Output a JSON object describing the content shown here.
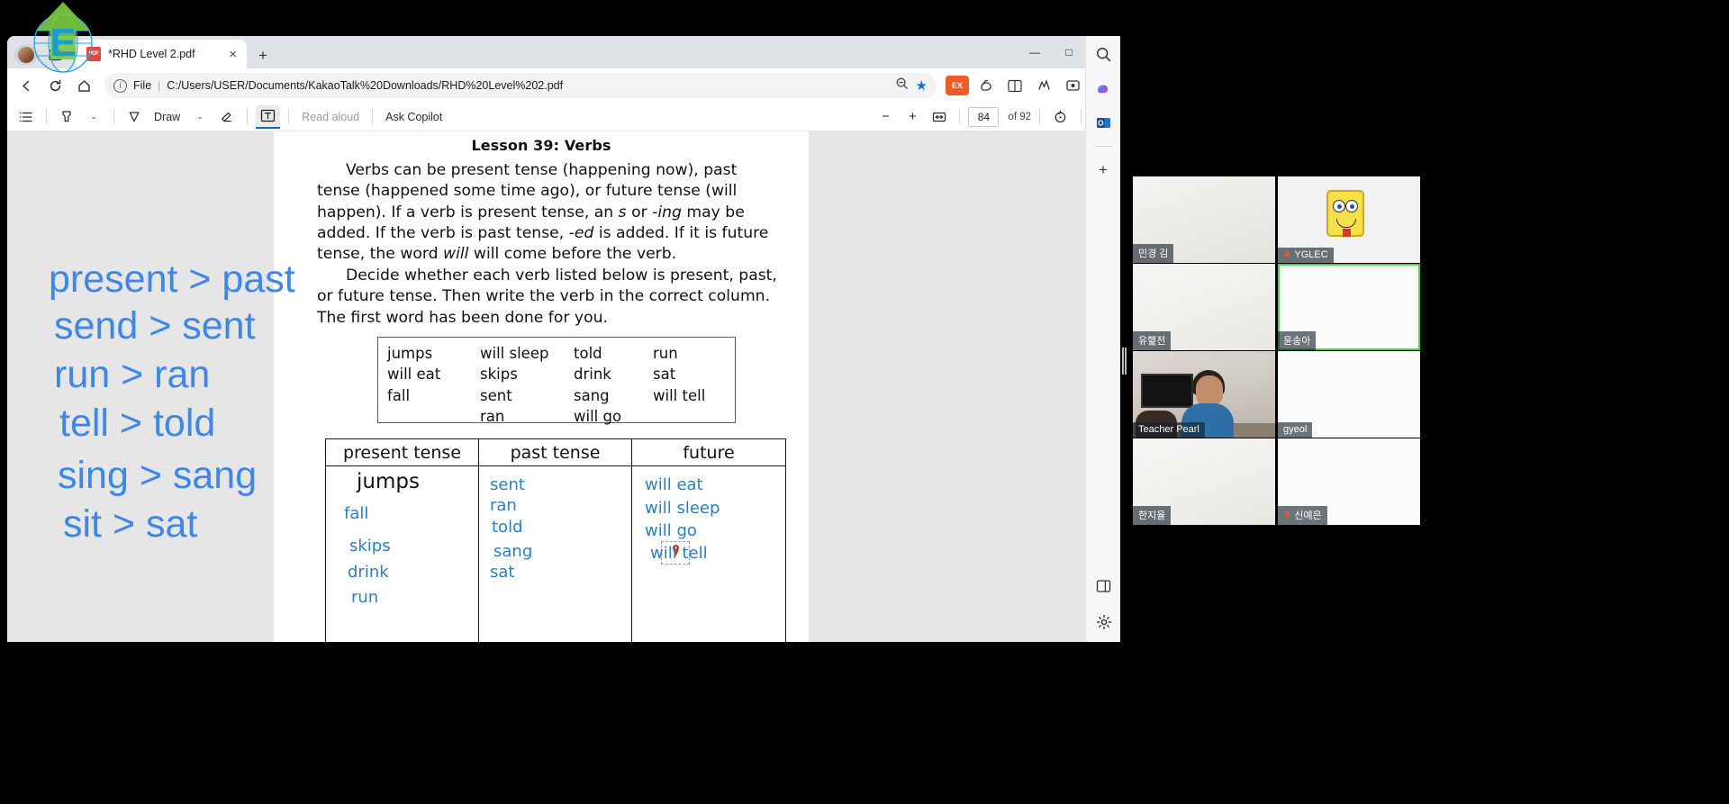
{
  "window": {
    "tab_title": "*RHD Level 2.pdf",
    "tab_close_label": "×",
    "new_tab_label": "+",
    "minimize_label": "—",
    "maximize_label": "□",
    "close_label": "✕",
    "profile_icon": "profile-avatar-icon",
    "split_screen_icon": "split-screen-icon"
  },
  "navbar": {
    "back_icon": "back-arrow-icon",
    "refresh_icon": "refresh-icon",
    "home_icon": "home-icon",
    "info_icon": "info-icon",
    "scheme_label": "File",
    "separator": "|",
    "url": "C:/Users/USER/Documents/KakaoTalk%20Downloads/RHD%20Level%202.pdf",
    "zoom_icon": "zoom-out-page-icon",
    "favorite_icon": "star-filled-icon",
    "extension_label": "EX",
    "copilot_icon": "copilot-icon",
    "split_icon": "split-screen-icon",
    "collections_icon": "collections-icon",
    "browser_essentials_icon": "browser-essentials-icon",
    "settings_more_icon": "more-options-icon"
  },
  "pdf_toolbar": {
    "contents_icon": "table-of-contents-icon",
    "highlight_icon": "highlighter-icon",
    "highlight_caret": "⌄",
    "draw_label": "Draw",
    "draw_icon": "pen-icon",
    "draw_caret": "⌄",
    "erase_icon": "eraser-icon",
    "text_icon": "add-text-icon",
    "read_aloud_label": "Read aloud",
    "ask_copilot_label": "Ask Copilot",
    "zoom_out_label": "−",
    "zoom_in_label": "+",
    "fit_page_icon": "fit-to-page-icon",
    "page_number": "84",
    "page_total": "of 92",
    "rotate_icon": "rotate-icon",
    "page_view_icon": "page-view-icon",
    "find_icon": "search-icon",
    "print_icon": "print-icon",
    "save_icon": "save-icon",
    "draw_sign_icon": "draw-signature-icon",
    "fullscreen_icon": "fullscreen-icon",
    "settings_icon": "gear-icon"
  },
  "annotations": {
    "color": "#3d87e8",
    "lines": [
      "present > past",
      "send > sent",
      "run > ran",
      "tell > told",
      "sing > sang",
      "sit > sat"
    ]
  },
  "document": {
    "title": "Lesson 39: Verbs",
    "paragraph1_parts": [
      "Verbs can be present tense (happening now), past tense (happened some time ago), or future tense (will happen). If a verb is present tense, an ",
      "s",
      " or ",
      "-ing",
      " may be added. If the verb is past tense, ",
      "-ed",
      " is added. If it is future tense, the word ",
      "will",
      " will come before the verb."
    ],
    "paragraph2": "Decide whether each verb listed below is present, past, or future tense. Then write the verb in the correct column. The first word has been done for you.",
    "word_bank": {
      "col1": [
        "jumps",
        "will eat",
        "fall"
      ],
      "col2": [
        "will sleep",
        "skips",
        "sent",
        "ran"
      ],
      "col3": [
        "told",
        "drink",
        "sang",
        "will go"
      ],
      "col4": [
        "run",
        "sat",
        "will tell"
      ]
    },
    "selected_word": "run",
    "table": {
      "headers": [
        "present tense",
        "past tense",
        "future"
      ],
      "present": [
        "jumps",
        "fall",
        "skips",
        "drink",
        "run"
      ],
      "past": [
        "sent",
        "ran",
        "told",
        "sang",
        "sat"
      ],
      "future": [
        "will eat",
        "will sleep",
        "will go",
        "will tell"
      ],
      "answer_color": "#2a7fc4",
      "example_word": "jumps"
    }
  },
  "conference": {
    "participants": [
      {
        "name": "민경 김",
        "muted": false
      },
      {
        "name": "YGLEC",
        "muted": true
      },
      {
        "name": "유햁전",
        "muted": false
      },
      {
        "name": "윤송아",
        "muted": false
      },
      {
        "name": "Teacher Pearl",
        "muted": false
      },
      {
        "name": "gyeol",
        "muted": false
      },
      {
        "name": "한지율",
        "muted": false
      },
      {
        "name": "신예은",
        "muted": true
      }
    ],
    "mute_icon": "microphone-muted-icon",
    "active_speaker_color": "#4bd14b"
  },
  "edge_sidebar": {
    "search_icon": "search-icon",
    "copilot_icon": "copilot-icon",
    "outlook_icon": "outlook-icon",
    "add_icon": "+",
    "split_icon": "split-screen-icon",
    "settings_icon": "gear-icon"
  }
}
